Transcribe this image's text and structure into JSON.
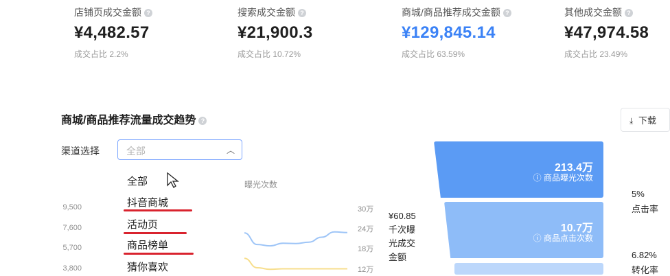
{
  "stats": [
    {
      "label": "店铺页成交金额",
      "value": "¥4,482.57",
      "share": "成交占比 2.2%"
    },
    {
      "label": "搜索成交金额",
      "value": "¥21,900.3",
      "share": "成交占比 10.72%"
    },
    {
      "label": "商城/商品推荐成交金额",
      "value": "¥129,845.14",
      "share": "成交占比 63.59%"
    },
    {
      "label": "其他成交金额",
      "value": "¥47,974.58",
      "share": "成交占比 23.49%"
    }
  ],
  "accent_color": "#3b82f6",
  "section": {
    "title": "商城/商品推荐流量成交趋势",
    "download_label": "下载"
  },
  "channel": {
    "label": "渠道选择",
    "placeholder": "全部",
    "options": [
      "全部",
      "抖音商城",
      "活动页",
      "商品榜单",
      "猜你喜欢"
    ]
  },
  "chart": {
    "series_label": "曝光次数",
    "left_ticks": [
      "9,500",
      "7,600",
      "5,700",
      "3,800"
    ],
    "right_ticks": [
      "30万",
      "24万",
      "18万",
      "12万"
    ]
  },
  "chart_data": {
    "type": "line",
    "series": [
      {
        "name": "曝光次数",
        "color": "#9ec5f7",
        "values": [
          22.5,
          19.0,
          18.6,
          19.4,
          19.3,
          19.7,
          21.2,
          22.8,
          22.6
        ]
      },
      {
        "name": "",
        "color": "#f7de8c",
        "values": [
          4700,
          3800,
          3650,
          3700,
          3700,
          3700,
          3700,
          3700,
          3700
        ]
      }
    ],
    "left_axis_ticks": [
      9500,
      7600,
      5700,
      3800
    ],
    "right_axis_ticks_wan": [
      30,
      24,
      18,
      12
    ]
  },
  "metric": {
    "value": "¥60.85",
    "label": "千次曝光成交金额"
  },
  "funnel": [
    {
      "value": "213.4万",
      "label": "商品曝光次数",
      "color": "#5b9bf4"
    },
    {
      "value": "10.7万",
      "label": "商品点击次数",
      "color": "#8ebcf8"
    }
  ],
  "rates": [
    {
      "value": "5%",
      "label": "点击率"
    },
    {
      "value": "6.82%",
      "label": "转化率"
    }
  ]
}
